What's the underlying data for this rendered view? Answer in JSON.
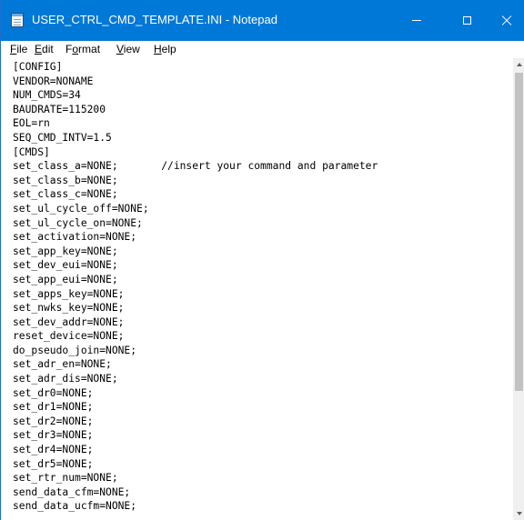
{
  "window": {
    "title": "USER_CTRL_CMD_TEMPLATE.INI - Notepad",
    "accent_color": "#0078d7"
  },
  "titlebar_icons": {
    "app": "notepad-icon",
    "minimize": "minimize-icon",
    "maximize": "maximize-icon",
    "close": "close-icon"
  },
  "menu": {
    "items": [
      {
        "mnemonic": "F",
        "rest": "ile"
      },
      {
        "mnemonic": "E",
        "rest": "dit"
      },
      {
        "pre": "F",
        "mnemonic": "o",
        "rest": "rmat"
      },
      {
        "mnemonic": "V",
        "rest": "iew"
      },
      {
        "mnemonic": "H",
        "rest": "elp"
      }
    ]
  },
  "editor": {
    "lines": [
      "[CONFIG]",
      "VENDOR=NONAME",
      "NUM_CMDS=34",
      "BAUDRATE=115200",
      "EOL=rn",
      "SEQ_CMD_INTV=1.5",
      "[CMDS]",
      "set_class_a=NONE;       //insert your command and parameter",
      "set_class_b=NONE;",
      "set_class_c=NONE;",
      "set_ul_cycle_off=NONE;",
      "set_ul_cycle_on=NONE;",
      "set_activation=NONE;",
      "set_app_key=NONE;",
      "set_dev_eui=NONE;",
      "set_app_eui=NONE;",
      "set_apps_key=NONE;",
      "set_nwks_key=NONE;",
      "set_dev_addr=NONE;",
      "reset_device=NONE;",
      "do_pseudo_join=NONE;",
      "set_adr_en=NONE;",
      "set_adr_dis=NONE;",
      "set_dr0=NONE;",
      "set_dr1=NONE;",
      "set_dr2=NONE;",
      "set_dr3=NONE;",
      "set_dr4=NONE;",
      "set_dr5=NONE;",
      "set_rtr_num=NONE;",
      "send_data_cfm=NONE;",
      "send_data_ucfm=NONE;"
    ]
  }
}
